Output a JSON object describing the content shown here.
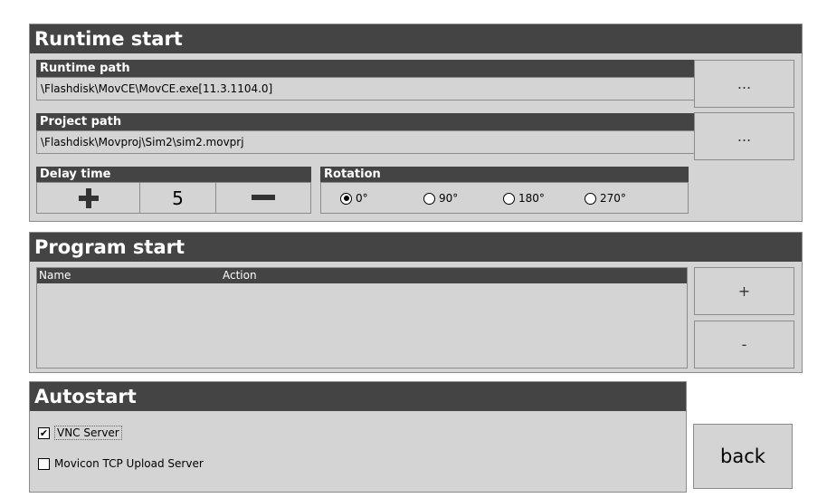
{
  "runtime": {
    "title": "Runtime start",
    "runtime_path": {
      "label": "Runtime path",
      "value": "\\Flashdisk\\MovCE\\MovCE.exe[11.3.1104.0]",
      "browse_label": "..."
    },
    "project_path": {
      "label": "Project path",
      "value": "\\Flashdisk\\Movproj\\Sim2\\sim2.movprj",
      "browse_label": "..."
    },
    "delay": {
      "label": "Delay time",
      "value": "5"
    },
    "rotation": {
      "label": "Rotation",
      "options": [
        "0°",
        "90°",
        "180°",
        "270°"
      ],
      "selected": "0°"
    }
  },
  "program": {
    "title": "Program start",
    "columns": [
      "Name",
      "Action"
    ],
    "add_label": "+",
    "remove_label": "-"
  },
  "autostart": {
    "title": "Autostart",
    "vnc": {
      "label": "VNC Server",
      "checked": true
    },
    "tcp": {
      "label": "Movicon TCP Upload Server",
      "checked": false
    }
  },
  "back_label": "back"
}
